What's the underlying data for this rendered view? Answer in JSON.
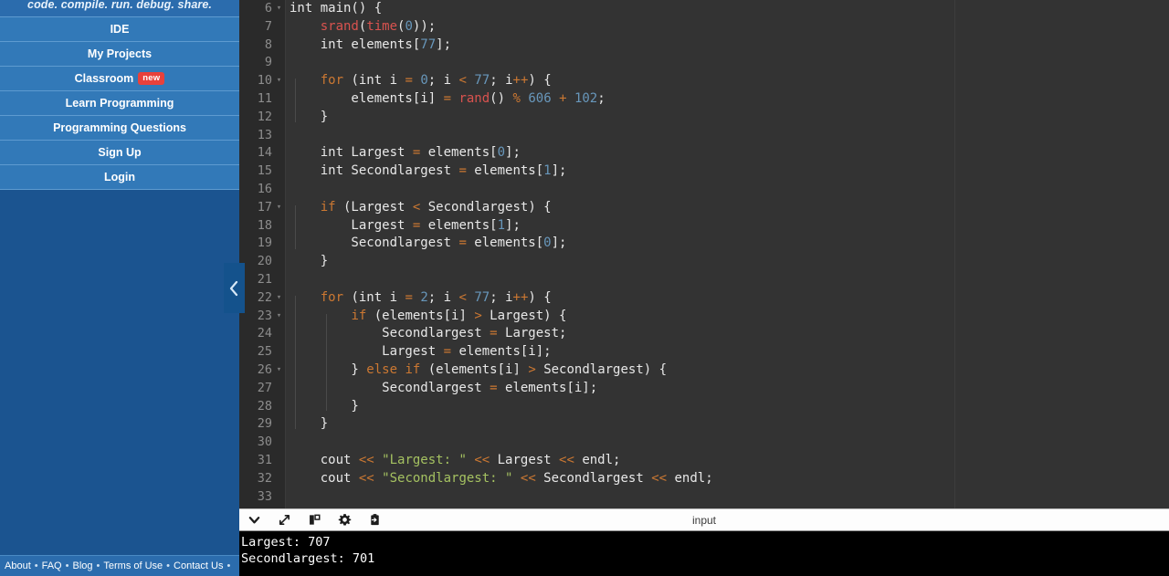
{
  "sidebar": {
    "tagline": "code. compile. run. debug. share.",
    "nav_items": [
      {
        "label": "IDE",
        "badge": null
      },
      {
        "label": "My Projects",
        "badge": null
      },
      {
        "label": "Classroom",
        "badge": "new"
      },
      {
        "label": "Learn Programming",
        "badge": null
      },
      {
        "label": "Programming Questions",
        "badge": null
      },
      {
        "label": "Sign Up",
        "badge": null
      },
      {
        "label": "Login",
        "badge": null
      }
    ],
    "collapse_icon": "chevron-left-icon",
    "footer_links": [
      "About",
      "FAQ",
      "Blog",
      "Terms of Use",
      "Contact Us"
    ],
    "footer_separator": "•"
  },
  "editor": {
    "language": "cpp",
    "first_visible_line": 6,
    "lines": [
      {
        "n": 6,
        "fold": true,
        "tokens": [
          {
            "t": "int main() {",
            "c": "pl"
          }
        ]
      },
      {
        "n": 7,
        "fold": false,
        "tokens": [
          {
            "t": "    ",
            "c": "pl"
          },
          {
            "t": "srand",
            "c": "fn"
          },
          {
            "t": "(",
            "c": "pl"
          },
          {
            "t": "time",
            "c": "fn"
          },
          {
            "t": "(",
            "c": "pl"
          },
          {
            "t": "0",
            "c": "num"
          },
          {
            "t": "));",
            "c": "pl"
          }
        ]
      },
      {
        "n": 8,
        "fold": false,
        "tokens": [
          {
            "t": "    int elements[",
            "c": "pl"
          },
          {
            "t": "77",
            "c": "num"
          },
          {
            "t": "];",
            "c": "pl"
          }
        ]
      },
      {
        "n": 9,
        "fold": false,
        "tokens": []
      },
      {
        "n": 10,
        "fold": true,
        "tokens": [
          {
            "t": "    ",
            "c": "pl"
          },
          {
            "t": "for",
            "c": "kw"
          },
          {
            "t": " (int i ",
            "c": "pl"
          },
          {
            "t": "=",
            "c": "op"
          },
          {
            "t": " ",
            "c": "pl"
          },
          {
            "t": "0",
            "c": "num"
          },
          {
            "t": "; i ",
            "c": "pl"
          },
          {
            "t": "<",
            "c": "op"
          },
          {
            "t": " ",
            "c": "pl"
          },
          {
            "t": "77",
            "c": "num"
          },
          {
            "t": "; i",
            "c": "pl"
          },
          {
            "t": "++",
            "c": "op"
          },
          {
            "t": ") {",
            "c": "pl"
          }
        ]
      },
      {
        "n": 11,
        "fold": false,
        "tokens": [
          {
            "t": "        elements[i] ",
            "c": "pl"
          },
          {
            "t": "=",
            "c": "op"
          },
          {
            "t": " ",
            "c": "pl"
          },
          {
            "t": "rand",
            "c": "fn"
          },
          {
            "t": "() ",
            "c": "pl"
          },
          {
            "t": "%",
            "c": "op"
          },
          {
            "t": " ",
            "c": "pl"
          },
          {
            "t": "606",
            "c": "num"
          },
          {
            "t": " ",
            "c": "pl"
          },
          {
            "t": "+",
            "c": "op"
          },
          {
            "t": " ",
            "c": "pl"
          },
          {
            "t": "102",
            "c": "num"
          },
          {
            "t": ";",
            "c": "pl"
          }
        ]
      },
      {
        "n": 12,
        "fold": false,
        "tokens": [
          {
            "t": "    }",
            "c": "pl"
          }
        ]
      },
      {
        "n": 13,
        "fold": false,
        "tokens": []
      },
      {
        "n": 14,
        "fold": false,
        "tokens": [
          {
            "t": "    int Largest ",
            "c": "pl"
          },
          {
            "t": "=",
            "c": "op"
          },
          {
            "t": " elements[",
            "c": "pl"
          },
          {
            "t": "0",
            "c": "num"
          },
          {
            "t": "];",
            "c": "pl"
          }
        ]
      },
      {
        "n": 15,
        "fold": false,
        "tokens": [
          {
            "t": "    int Secondlargest ",
            "c": "pl"
          },
          {
            "t": "=",
            "c": "op"
          },
          {
            "t": " elements[",
            "c": "pl"
          },
          {
            "t": "1",
            "c": "num"
          },
          {
            "t": "];",
            "c": "pl"
          }
        ]
      },
      {
        "n": 16,
        "fold": false,
        "tokens": []
      },
      {
        "n": 17,
        "fold": true,
        "tokens": [
          {
            "t": "    ",
            "c": "pl"
          },
          {
            "t": "if",
            "c": "kw"
          },
          {
            "t": " (Largest ",
            "c": "pl"
          },
          {
            "t": "<",
            "c": "op"
          },
          {
            "t": " Secondlargest) {",
            "c": "pl"
          }
        ]
      },
      {
        "n": 18,
        "fold": false,
        "tokens": [
          {
            "t": "        Largest ",
            "c": "pl"
          },
          {
            "t": "=",
            "c": "op"
          },
          {
            "t": " elements[",
            "c": "pl"
          },
          {
            "t": "1",
            "c": "num"
          },
          {
            "t": "];",
            "c": "pl"
          }
        ]
      },
      {
        "n": 19,
        "fold": false,
        "tokens": [
          {
            "t": "        Secondlargest ",
            "c": "pl"
          },
          {
            "t": "=",
            "c": "op"
          },
          {
            "t": " elements[",
            "c": "pl"
          },
          {
            "t": "0",
            "c": "num"
          },
          {
            "t": "];",
            "c": "pl"
          }
        ]
      },
      {
        "n": 20,
        "fold": false,
        "tokens": [
          {
            "t": "    }",
            "c": "pl"
          }
        ]
      },
      {
        "n": 21,
        "fold": false,
        "tokens": []
      },
      {
        "n": 22,
        "fold": true,
        "tokens": [
          {
            "t": "    ",
            "c": "pl"
          },
          {
            "t": "for",
            "c": "kw"
          },
          {
            "t": " (int i ",
            "c": "pl"
          },
          {
            "t": "=",
            "c": "op"
          },
          {
            "t": " ",
            "c": "pl"
          },
          {
            "t": "2",
            "c": "num"
          },
          {
            "t": "; i ",
            "c": "pl"
          },
          {
            "t": "<",
            "c": "op"
          },
          {
            "t": " ",
            "c": "pl"
          },
          {
            "t": "77",
            "c": "num"
          },
          {
            "t": "; i",
            "c": "pl"
          },
          {
            "t": "++",
            "c": "op"
          },
          {
            "t": ") {",
            "c": "pl"
          }
        ]
      },
      {
        "n": 23,
        "fold": true,
        "tokens": [
          {
            "t": "        ",
            "c": "pl"
          },
          {
            "t": "if",
            "c": "kw"
          },
          {
            "t": " (elements[i] ",
            "c": "pl"
          },
          {
            "t": ">",
            "c": "op"
          },
          {
            "t": " Largest) {",
            "c": "pl"
          }
        ]
      },
      {
        "n": 24,
        "fold": false,
        "tokens": [
          {
            "t": "            Secondlargest ",
            "c": "pl"
          },
          {
            "t": "=",
            "c": "op"
          },
          {
            "t": " Largest;",
            "c": "pl"
          }
        ]
      },
      {
        "n": 25,
        "fold": false,
        "tokens": [
          {
            "t": "            Largest ",
            "c": "pl"
          },
          {
            "t": "=",
            "c": "op"
          },
          {
            "t": " elements[i];",
            "c": "pl"
          }
        ]
      },
      {
        "n": 26,
        "fold": true,
        "tokens": [
          {
            "t": "        } ",
            "c": "pl"
          },
          {
            "t": "else",
            "c": "kw"
          },
          {
            "t": " ",
            "c": "pl"
          },
          {
            "t": "if",
            "c": "kw"
          },
          {
            "t": " (elements[i] ",
            "c": "pl"
          },
          {
            "t": ">",
            "c": "op"
          },
          {
            "t": " Secondlargest) {",
            "c": "pl"
          }
        ]
      },
      {
        "n": 27,
        "fold": false,
        "tokens": [
          {
            "t": "            Secondlargest ",
            "c": "pl"
          },
          {
            "t": "=",
            "c": "op"
          },
          {
            "t": " elements[i];",
            "c": "pl"
          }
        ]
      },
      {
        "n": 28,
        "fold": false,
        "tokens": [
          {
            "t": "        }",
            "c": "pl"
          }
        ]
      },
      {
        "n": 29,
        "fold": false,
        "tokens": [
          {
            "t": "    }",
            "c": "pl"
          }
        ]
      },
      {
        "n": 30,
        "fold": false,
        "tokens": []
      },
      {
        "n": 31,
        "fold": false,
        "tokens": [
          {
            "t": "    cout ",
            "c": "pl"
          },
          {
            "t": "<<",
            "c": "op"
          },
          {
            "t": " ",
            "c": "pl"
          },
          {
            "t": "\"Largest: \"",
            "c": "str"
          },
          {
            "t": " ",
            "c": "pl"
          },
          {
            "t": "<<",
            "c": "op"
          },
          {
            "t": " Largest ",
            "c": "pl"
          },
          {
            "t": "<<",
            "c": "op"
          },
          {
            "t": " endl;",
            "c": "pl"
          }
        ]
      },
      {
        "n": 32,
        "fold": false,
        "tokens": [
          {
            "t": "    cout ",
            "c": "pl"
          },
          {
            "t": "<<",
            "c": "op"
          },
          {
            "t": " ",
            "c": "pl"
          },
          {
            "t": "\"Secondlargest: \"",
            "c": "str"
          },
          {
            "t": " ",
            "c": "pl"
          },
          {
            "t": "<<",
            "c": "op"
          },
          {
            "t": " Secondlargest ",
            "c": "pl"
          },
          {
            "t": "<<",
            "c": "op"
          },
          {
            "t": " endl;",
            "c": "pl"
          }
        ]
      },
      {
        "n": 33,
        "fold": false,
        "tokens": []
      }
    ],
    "colors": {
      "background": "#333333",
      "gutter": "#2a2a2a",
      "keyword": "#cc7832",
      "function": "#d9534f",
      "number": "#6897bb",
      "string": "#a5c261",
      "plain": "#e8e8e8",
      "line_number": "#8d8d8d"
    }
  },
  "console": {
    "toolbar_icons": [
      {
        "name": "chevron-down-icon",
        "title": "collapse"
      },
      {
        "name": "expand-arrows-icon",
        "title": "expand"
      },
      {
        "name": "panel-layout-icon",
        "title": "layout"
      },
      {
        "name": "gear-icon",
        "title": "settings"
      },
      {
        "name": "paste-clipboard-icon",
        "title": "paste"
      }
    ],
    "center_label": "input",
    "output_lines": [
      "Largest: 707",
      "Secondlargest: 701"
    ]
  }
}
